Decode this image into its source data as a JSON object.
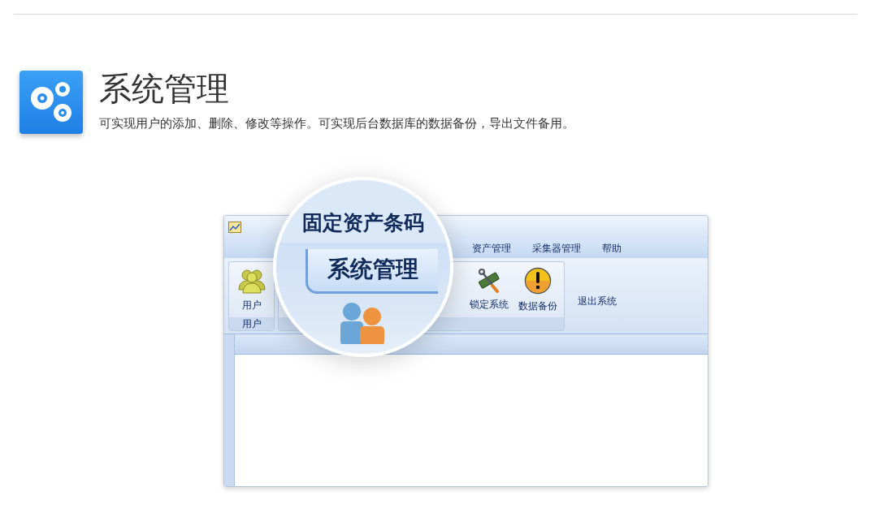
{
  "header": {
    "title": "系统管理",
    "description": "可实现用户的添加、删除、修改等操作。可实现后台数据库的数据备份，导出文件备用。"
  },
  "app_window": {
    "menu_tabs": [
      {
        "label": "资产管理",
        "selected": false
      },
      {
        "label": "采集器管理",
        "selected": false
      },
      {
        "label": "帮助",
        "selected": false
      }
    ],
    "ribbon_groups": [
      {
        "label": "用户",
        "buttons": [
          {
            "label": "用户",
            "kind": "users"
          }
        ]
      },
      {
        "buttons": [
          {
            "label": "锁定系统",
            "kind": "tools"
          },
          {
            "label": "数据备份",
            "kind": "warning"
          }
        ]
      }
    ],
    "exit_button": "退出系统"
  },
  "magnifier": {
    "title": "固定资产条码",
    "tab_label": "系统管理"
  }
}
